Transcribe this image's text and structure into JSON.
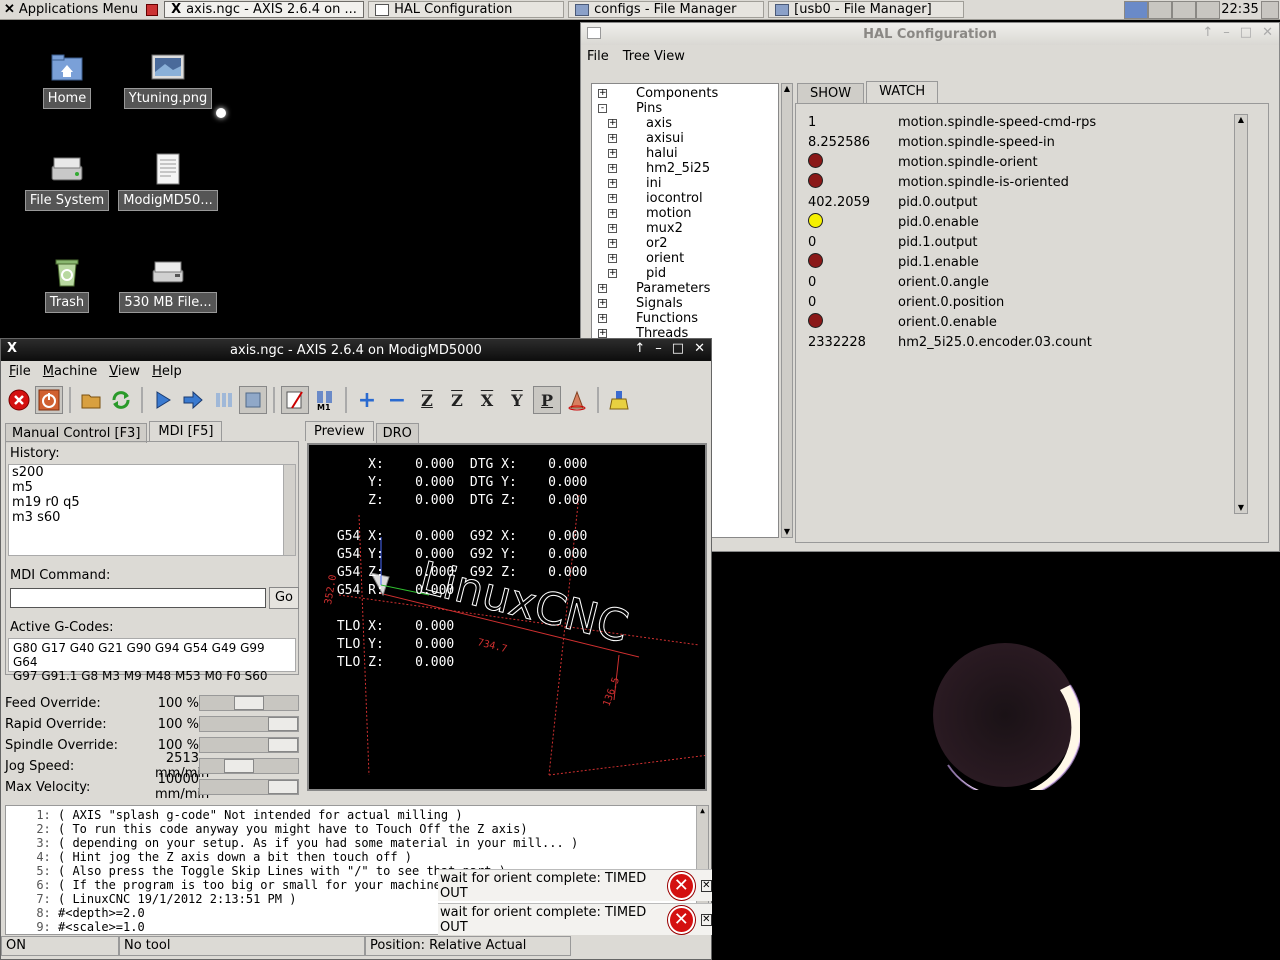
{
  "taskbar": {
    "menu_label": "Applications Menu",
    "tasks": [
      {
        "label": "axis.ngc - AXIS 2.6.4 on ..."
      },
      {
        "label": "HAL Configuration"
      },
      {
        "label": "configs - File Manager"
      },
      {
        "label": "[usb0 - File Manager]"
      }
    ],
    "clock": "22:35"
  },
  "desktop": {
    "icons": [
      {
        "label": "Home",
        "icon": "home-folder-icon"
      },
      {
        "label": "Ytuning.png",
        "icon": "image-file-icon"
      },
      {
        "label": "File System",
        "icon": "drive-icon"
      },
      {
        "label": "ModigMD50...",
        "icon": "text-file-icon"
      },
      {
        "label": "Trash",
        "icon": "trash-icon"
      },
      {
        "label": "530 MB File...",
        "icon": "removable-drive-icon"
      }
    ]
  },
  "hal": {
    "title": "HAL Configuration",
    "menu": [
      "File",
      "Tree View"
    ],
    "tree": [
      {
        "label": "Components",
        "level": 0,
        "expander": "+"
      },
      {
        "label": "Pins",
        "level": 0,
        "expander": "-"
      },
      {
        "label": "axis",
        "level": 1,
        "expander": "+"
      },
      {
        "label": "axisui",
        "level": 1,
        "expander": "+"
      },
      {
        "label": "halui",
        "level": 1,
        "expander": "+"
      },
      {
        "label": "hm2_5i25",
        "level": 1,
        "expander": "+"
      },
      {
        "label": "ini",
        "level": 1,
        "expander": "+"
      },
      {
        "label": "iocontrol",
        "level": 1,
        "expander": "+"
      },
      {
        "label": "motion",
        "level": 1,
        "expander": "+"
      },
      {
        "label": "mux2",
        "level": 1,
        "expander": "+"
      },
      {
        "label": "or2",
        "level": 1,
        "expander": "+"
      },
      {
        "label": "orient",
        "level": 1,
        "expander": "+"
      },
      {
        "label": "pid",
        "level": 1,
        "expander": "+"
      },
      {
        "label": "Parameters",
        "level": 0,
        "expander": "+"
      },
      {
        "label": "Signals",
        "level": 0,
        "expander": "+"
      },
      {
        "label": "Functions",
        "level": 0,
        "expander": "+"
      },
      {
        "label": "Threads",
        "level": 0,
        "expander": "+"
      }
    ],
    "tabs": [
      "SHOW",
      "WATCH"
    ],
    "watch": [
      {
        "value": "1",
        "led": null,
        "name": "motion.spindle-speed-cmd-rps"
      },
      {
        "value": "8.252586",
        "led": null,
        "name": "motion.spindle-speed-in"
      },
      {
        "value": "",
        "led": "off",
        "name": "motion.spindle-orient"
      },
      {
        "value": "",
        "led": "off",
        "name": "motion.spindle-is-oriented"
      },
      {
        "value": "402.2059",
        "led": null,
        "name": "pid.0.output"
      },
      {
        "value": "",
        "led": "on",
        "name": "pid.0.enable"
      },
      {
        "value": "0",
        "led": null,
        "name": "pid.1.output"
      },
      {
        "value": "",
        "led": "off",
        "name": "pid.1.enable"
      },
      {
        "value": "0",
        "led": null,
        "name": "orient.0.angle"
      },
      {
        "value": "0",
        "led": null,
        "name": "orient.0.position"
      },
      {
        "value": "",
        "led": "off",
        "name": "orient.0.enable"
      },
      {
        "value": "2332228",
        "led": null,
        "name": "hm2_5i25.0.encoder.03.count"
      }
    ]
  },
  "axis": {
    "title": "axis.ngc - AXIS 2.6.4 on ModigMD5000",
    "menu": [
      "File",
      "Machine",
      "View",
      "Help"
    ],
    "toolbar": [
      "estop-icon",
      "power-icon",
      "open-file-icon",
      "reload-icon",
      "run-icon",
      "step-icon",
      "pause-icon",
      "stop-icon",
      "skip-lines-icon",
      "optional-stop-icon",
      "zoom-in-icon",
      "zoom-out-icon",
      "view-z-icon",
      "view-z2-icon",
      "view-x-icon",
      "view-y-icon",
      "view-p-icon",
      "rotate-icon",
      "clear-plot-icon"
    ],
    "left_tabs": [
      "Manual Control [F3]",
      "MDI [F5]"
    ],
    "history_label": "History:",
    "history": [
      "s200",
      "m5",
      "m19 r0 q5",
      "m3 s60"
    ],
    "mdi_label": "MDI Command:",
    "mdi_value": "",
    "go_label": "Go",
    "gcodes_label": "Active G-Codes:",
    "gcodes_line1": "G80 G17 G40 G21 G90 G94 G54 G49 G99 G64",
    "gcodes_line2": "G97 G91.1 G8 M3 M9 M48 M53 M0 F0 S60",
    "overrides": [
      {
        "name": "Feed Override:",
        "value": "100 %",
        "level": 0.5
      },
      {
        "name": "Rapid Override:",
        "value": "100 %",
        "level": 1.0
      },
      {
        "name": "Spindle Override:",
        "value": "100 %",
        "level": 1.0
      },
      {
        "name": "Jog Speed:",
        "value": "2513 mm/min",
        "level": 0.35
      },
      {
        "name": "Max Velocity:",
        "value": "10000 mm/min",
        "level": 1.0
      }
    ],
    "right_tabs": [
      "Preview",
      "DRO"
    ],
    "dro": [
      "     X:    0.000  DTG X:    0.000",
      "     Y:    0.000  DTG Y:    0.000",
      "     Z:    0.000  DTG Z:    0.000",
      "",
      " G54 X:    0.000  G92 X:    0.000",
      " G54 Y:    0.000  G92 Y:    0.000",
      " G54 Z:    0.000  G92 Z:    0.000",
      " G54 R:    0.000",
      "",
      " TLO X:    0.000",
      " TLO Y:    0.000",
      " TLO Z:    0.000"
    ],
    "preview_text": "LinuxCNC",
    "preview_dims": [
      "734.7",
      "136.5",
      "352.0"
    ],
    "code": [
      "( AXIS \"splash g-code\" Not intended for actual milling )",
      "( To run this code anyway you might have to Touch Off the Z axis)",
      "( depending on your setup. As if you had some material in your mill... )",
      "( Hint jog the Z axis down a bit then touch off )",
      "( Also press the Toggle Skip Lines with \"/\" to see that part )",
      "( If the program is too big or small for your machine, change the scale #3 )",
      "( LinuxCNC 19/1/2012 2:13:51 PM )",
      "#<depth>=2.0",
      "#<scale>=1.0"
    ],
    "notifications": [
      {
        "text": "wait for orient complete: TIMED OUT"
      },
      {
        "text": "wait for orient complete: TIMED OUT"
      }
    ],
    "status": [
      "ON",
      "No tool",
      "Position: Relative Actual"
    ]
  },
  "colors": {
    "led_off": "#8a1818",
    "led_on": "#f5f000",
    "error": "#d41010",
    "preview_dim": "#d03030"
  }
}
